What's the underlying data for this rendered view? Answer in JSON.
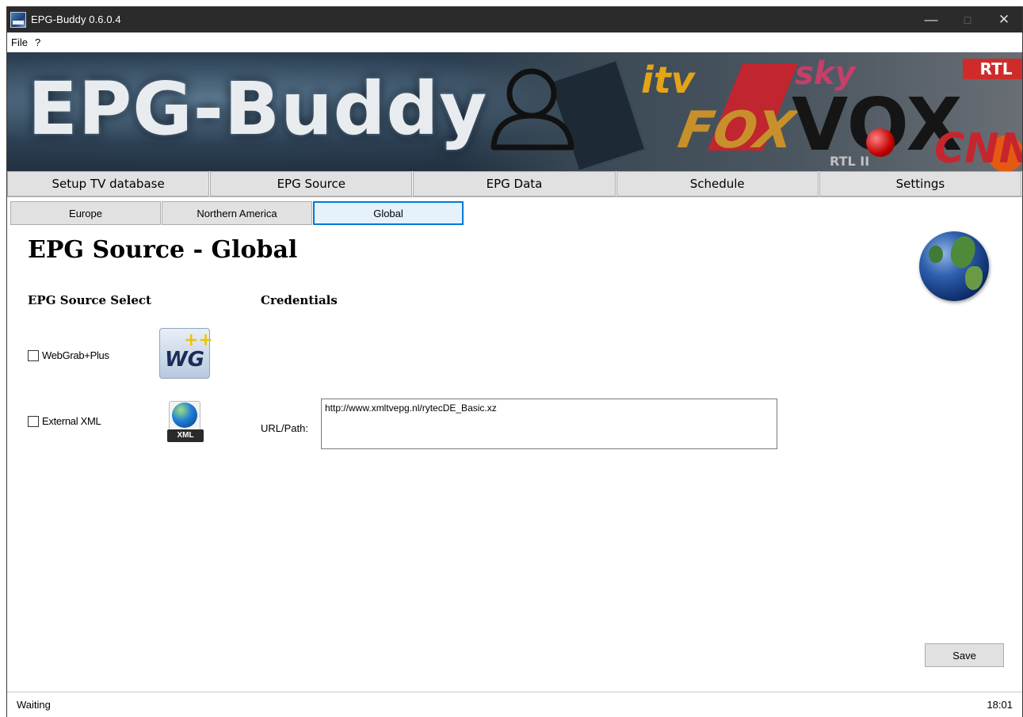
{
  "window": {
    "title": "EPG-Buddy 0.6.0.4",
    "controls": {
      "minimize": "—",
      "maximize": "□",
      "close": "✕"
    }
  },
  "menu": {
    "items": [
      "File",
      "?"
    ]
  },
  "banner": {
    "title": "EPG-Buddy",
    "logos": {
      "itv": "itv",
      "fox": "FOX",
      "sky": "sky",
      "vox": "VOX",
      "rtl": "RTL",
      "cnn": "CNN",
      "rtl2": "RTL II"
    }
  },
  "main_tabs": [
    "Setup TV database",
    "EPG Source",
    "EPG Data",
    "Schedule",
    "Settings"
  ],
  "sub_tabs": {
    "items": [
      "Europe",
      "Northern America",
      "Global"
    ],
    "active": "Global"
  },
  "page": {
    "title": "EPG Source - Global",
    "source_select_heading": "EPG Source Select",
    "credentials_heading": "Credentials",
    "sources": [
      {
        "label": "WebGrab+Plus",
        "checked": false,
        "icon": "webgrab-plus-icon"
      },
      {
        "label": "External XML",
        "checked": false,
        "icon": "xml-globe-icon"
      }
    ],
    "wg_icon_text": "WG",
    "wg_icon_plus": "++",
    "xml_icon_text": "XML",
    "url_label": "URL/Path:",
    "url_value": "http://www.xmltvepg.nl/rytecDE_Basic.xz",
    "save_label": "Save"
  },
  "status": {
    "text": "Waiting",
    "time": "18:01"
  }
}
